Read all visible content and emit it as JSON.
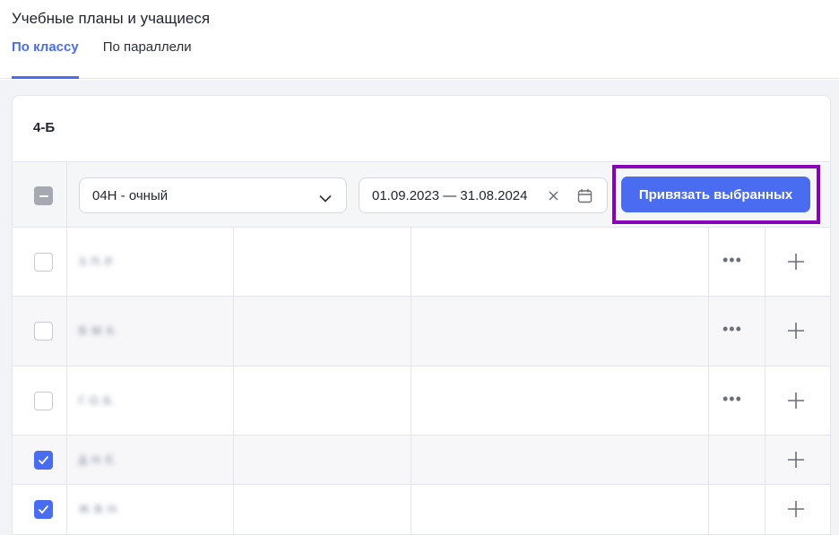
{
  "header": {
    "title": "Учебные планы и учащиеся",
    "tabs": [
      {
        "label": "По классу",
        "active": true
      },
      {
        "label": "По параллели",
        "active": false
      }
    ]
  },
  "card": {
    "class_name": "4-Б",
    "toolbar": {
      "plan_select": {
        "value": "04Н - очный"
      },
      "date_range": {
        "value": "01.09.2023 — 31.08.2024"
      },
      "bind_button_label": "Привязать выбранных"
    },
    "rows": [
      {
        "checked": false,
        "name": "З. П. Р.",
        "has_more_menu": true
      },
      {
        "checked": false,
        "name": "В. М. К.",
        "has_more_menu": true
      },
      {
        "checked": false,
        "name": "Г. О. Б.",
        "has_more_menu": true
      },
      {
        "checked": true,
        "name": "Д. Н. Е.",
        "has_more_menu": false
      },
      {
        "checked": true,
        "name": "Ж. В. Н.",
        "has_more_menu": false
      }
    ]
  },
  "colors": {
    "accent": "#4a6cf0",
    "highlight_frame": "#8a00b8"
  },
  "icons": [
    "chevron-down-icon",
    "close-icon",
    "calendar-icon",
    "check-icon",
    "more-icon",
    "plus-icon"
  ]
}
